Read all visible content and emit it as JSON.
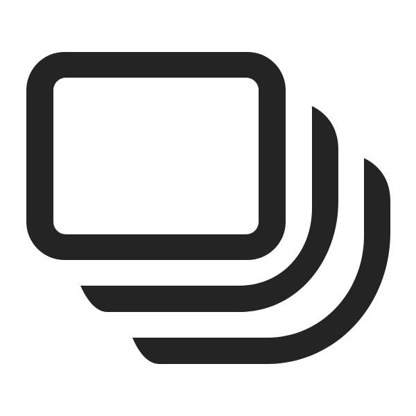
{
  "icon": {
    "name": "stacked-cards-icon",
    "color": "#242424",
    "background": "#ffffff"
  }
}
